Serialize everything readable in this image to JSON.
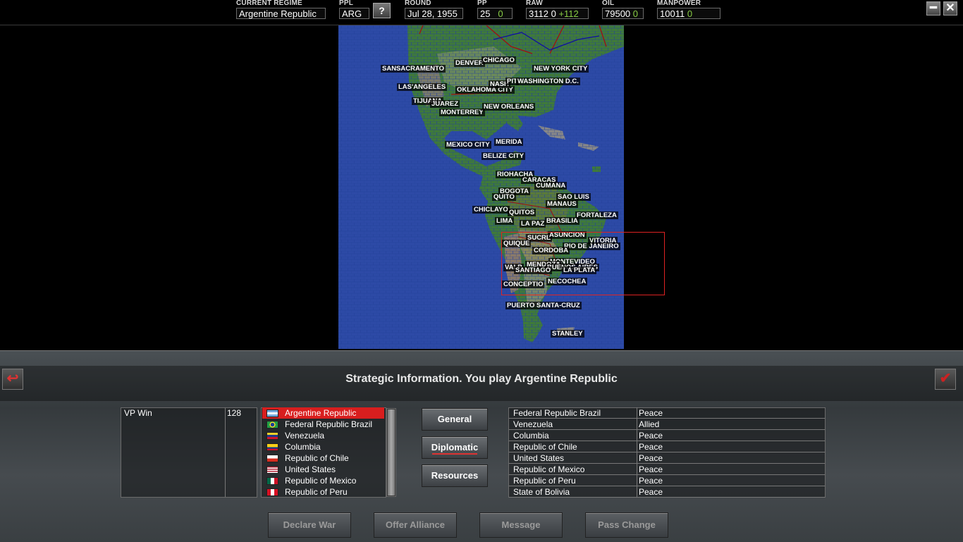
{
  "topbar": {
    "regime": {
      "label": "CURRENT REGIME",
      "value": "Argentine Republic"
    },
    "ppl": {
      "label": "PPL",
      "value": "ARG"
    },
    "help_label": "?",
    "round": {
      "label": "ROUND",
      "value": "Jul 28, 1955"
    },
    "pp": {
      "label": "PP",
      "value": "25",
      "delta": "0"
    },
    "raw": {
      "label": "RAW",
      "value": "3112",
      "delta": "0",
      "income": "+112"
    },
    "oil": {
      "label": "OIL",
      "value": "79500",
      "delta": "0"
    },
    "manpower": {
      "label": "MANPOWER",
      "value": "10011",
      "delta": "0"
    },
    "minimize_icon": "minimize-icon",
    "close_icon": "close-icon"
  },
  "map": {
    "cities": [
      "SANSACRAMENTO",
      "DENVER",
      "CHICAGO",
      "NEW YORK CITY",
      "LAS'ANGELES",
      "OKLAHOMA CITY",
      "NASH",
      "PIT",
      "WASHINGTON D.C.",
      "TIJUANA",
      "JUAREZ",
      "MONTERREY",
      "NEW ORLEANS",
      "MEXICO CITY",
      "MERIDA",
      "BELIZE CITY",
      "RIOHACHA",
      "CARACAS",
      "BOGOTA",
      "CUMANA",
      "SAO LUIS",
      "QUITO",
      "MANAUS",
      "CHICLAYO",
      "QUITOS",
      "FORTALEZA",
      "LIMA",
      "LA PAZ",
      "BRASILIA",
      "SUCRE",
      "ASUNCION",
      "VITORIA",
      "QUIQUE",
      "RIO DE JANEIRO",
      "CORDOBA",
      "MONTEVIDEO",
      "VALP",
      "MENDOZA",
      "BUENOS AIRES",
      "SANTIAGO",
      "LA PLATA",
      "CONCEPTIO",
      "NECOCHEA",
      "PUERTO SANTA-CRUZ",
      "STANLEY"
    ]
  },
  "strip": {
    "title": "Strategic Information. You play Argentine Republic",
    "back_icon": "back-arrow-icon",
    "confirm_icon": "checkmark-icon"
  },
  "vp": {
    "label": "VP Win",
    "value": "128"
  },
  "nations": [
    {
      "name": "Argentine Republic",
      "flag": "argentina-flag-icon"
    },
    {
      "name": "Federal Republic Brazil",
      "flag": "brazil-flag-icon"
    },
    {
      "name": "Venezuela",
      "flag": "venezuela-flag-icon"
    },
    {
      "name": "Columbia",
      "flag": "colombia-flag-icon"
    },
    {
      "name": "Republic of Chile",
      "flag": "chile-flag-icon"
    },
    {
      "name": "United States",
      "flag": "usa-flag-icon"
    },
    {
      "name": "Republic of Mexico",
      "flag": "mexico-flag-icon"
    },
    {
      "name": "Republic of Peru",
      "flag": "peru-flag-icon"
    }
  ],
  "tabs": {
    "general": "General",
    "diplomatic": "Diplomatic",
    "resources": "Resources"
  },
  "relations": [
    {
      "nation": "Federal Republic Brazil",
      "status": "Peace"
    },
    {
      "nation": "Venezuela",
      "status": "Allied"
    },
    {
      "nation": "Columbia",
      "status": "Peace"
    },
    {
      "nation": "Republic of Chile",
      "status": "Peace"
    },
    {
      "nation": "United States",
      "status": "Peace"
    },
    {
      "nation": "Republic of Mexico",
      "status": "Peace"
    },
    {
      "nation": "Republic of Peru",
      "status": "Peace"
    },
    {
      "nation": "State of Bolivia",
      "status": "Peace"
    }
  ],
  "actions": {
    "declare_war": "Declare War",
    "offer_alliance": "Offer Alliance",
    "message": "Message",
    "pass_change": "Pass Change"
  },
  "colors": {
    "ocean": "#2d4aa6",
    "land": "#3f7a3a",
    "selected": "#d81e1e",
    "focus": "#dd2222"
  }
}
